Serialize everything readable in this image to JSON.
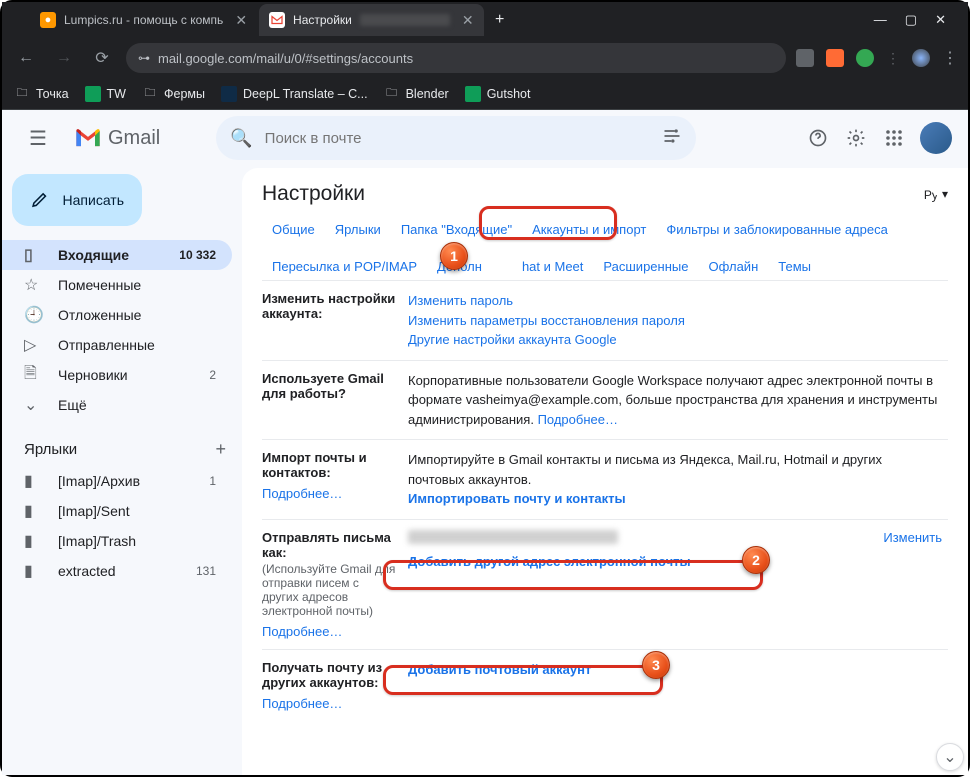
{
  "browser": {
    "tabs": [
      {
        "title": "Lumpics.ru - помощь с компь",
        "favicon_bg": "#ff9800",
        "favicon_text": "L"
      },
      {
        "title": "Настройки",
        "favicon_bg": "#ffffff",
        "favicon_text": "M"
      }
    ],
    "url": "mail.google.com/mail/u/0/#settings/accounts",
    "bookmarks": [
      {
        "label": "Точка",
        "icon": "📁"
      },
      {
        "label": "TW",
        "icon_bg": "#0f9d58"
      },
      {
        "label": "Фермы",
        "icon": "📁"
      },
      {
        "label": "DeepL Translate – С...",
        "icon_bg": "#0f2b46"
      },
      {
        "label": "Blender",
        "icon": "📁"
      },
      {
        "label": "Gutshot",
        "icon_bg": "#0f9d58"
      }
    ]
  },
  "gmail": {
    "brand": "Gmail",
    "search_placeholder": "Поиск в почте",
    "compose": "Написать",
    "nav": [
      {
        "icon": "▥",
        "label": "Входящие",
        "count": "10 332",
        "active": true
      },
      {
        "icon": "☆",
        "label": "Помеченные"
      },
      {
        "icon": "🕘",
        "label": "Отложенные"
      },
      {
        "icon": "➤",
        "label": "Отправленные"
      },
      {
        "icon": "🗎",
        "label": "Черновики",
        "count": "2"
      },
      {
        "icon": "⌄",
        "label": "Ещё"
      }
    ],
    "labels_header": "Ярлыки",
    "labels": [
      {
        "label": "[Imap]/Архив",
        "count": "1"
      },
      {
        "label": "[Imap]/Sent"
      },
      {
        "label": "[Imap]/Trash"
      },
      {
        "label": "extracted",
        "count": "131"
      }
    ]
  },
  "settings": {
    "title": "Настройки",
    "lang": "Рꭚ",
    "tabs_row1": [
      "Общие",
      "Ярлыки",
      "Папка \"Входящие\"",
      "Аккаунты и импорт",
      "Фильтры и заблокированные адреса"
    ],
    "tabs_row2": [
      "Пересылка и POP/IMAP",
      "Дополн",
      "hat и Meet",
      "Расширенные",
      "Офлайн",
      "Темы"
    ],
    "active_tab": "Аккаунты и импорт",
    "sections": {
      "account": {
        "label": "Изменить настройки аккаунта:",
        "links": [
          "Изменить пароль",
          "Изменить параметры восстановления пароля",
          "Другие настройки аккаунта Google"
        ]
      },
      "workspace": {
        "label": "Используете Gmail для работы?",
        "text": "Корпоративные пользователи Google Workspace получают адрес электронной почты в формате vasheimya@example.com, больше пространства для хранения и инструменты администрирования. ",
        "more": "Подробнее…"
      },
      "import": {
        "label": "Импорт почты и контактов:",
        "more": "Подробнее…",
        "text": "Импортируйте в Gmail контакты и письма из Яндекса, Mail.ru, Hotmail и других почтовых аккаунтов.",
        "link": "Импортировать почту и контакты"
      },
      "sendas": {
        "label": "Отправлять письма как:",
        "sub": "(Используйте Gmail для отправки писем с других адресов электронной почты)",
        "more": "Подробнее…",
        "link": "Добавить другой адрес электронной почты",
        "edit": "Изменить"
      },
      "receive": {
        "label": "Получать почту из других аккаунтов:",
        "more": "Подробнее…",
        "link": "Добавить почтовый аккаунт"
      }
    }
  },
  "annotations": {
    "m1": "1",
    "m2": "2",
    "m3": "3"
  }
}
